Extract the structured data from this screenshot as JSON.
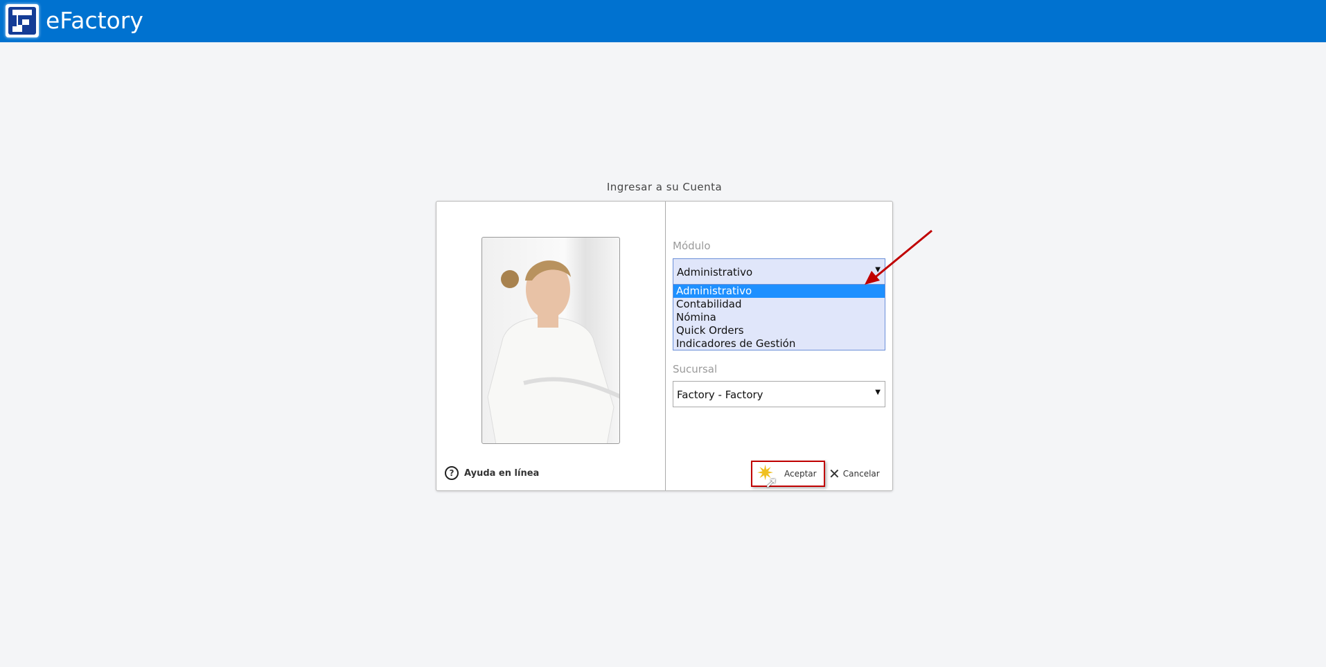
{
  "header": {
    "app_title": "eFactory",
    "logo_icon": "efactory-logo"
  },
  "login": {
    "title": "Ingresar a su Cuenta",
    "modulo": {
      "label": "Módulo",
      "value": "Administrativo",
      "options": [
        "Administrativo",
        "Contabilidad",
        "Nómina",
        "Quick Orders",
        "Indicadores de Gestión"
      ],
      "selected_index": 0
    },
    "sucursal": {
      "label": "Sucursal",
      "value": "Factory - Factory"
    },
    "help_label": "Ayuda en línea",
    "accept_label": "Aceptar",
    "cancel_label": "Cancelar"
  },
  "colors": {
    "header": "#0072d0",
    "highlight": "#1e90ff",
    "annotation": "#c00000"
  }
}
